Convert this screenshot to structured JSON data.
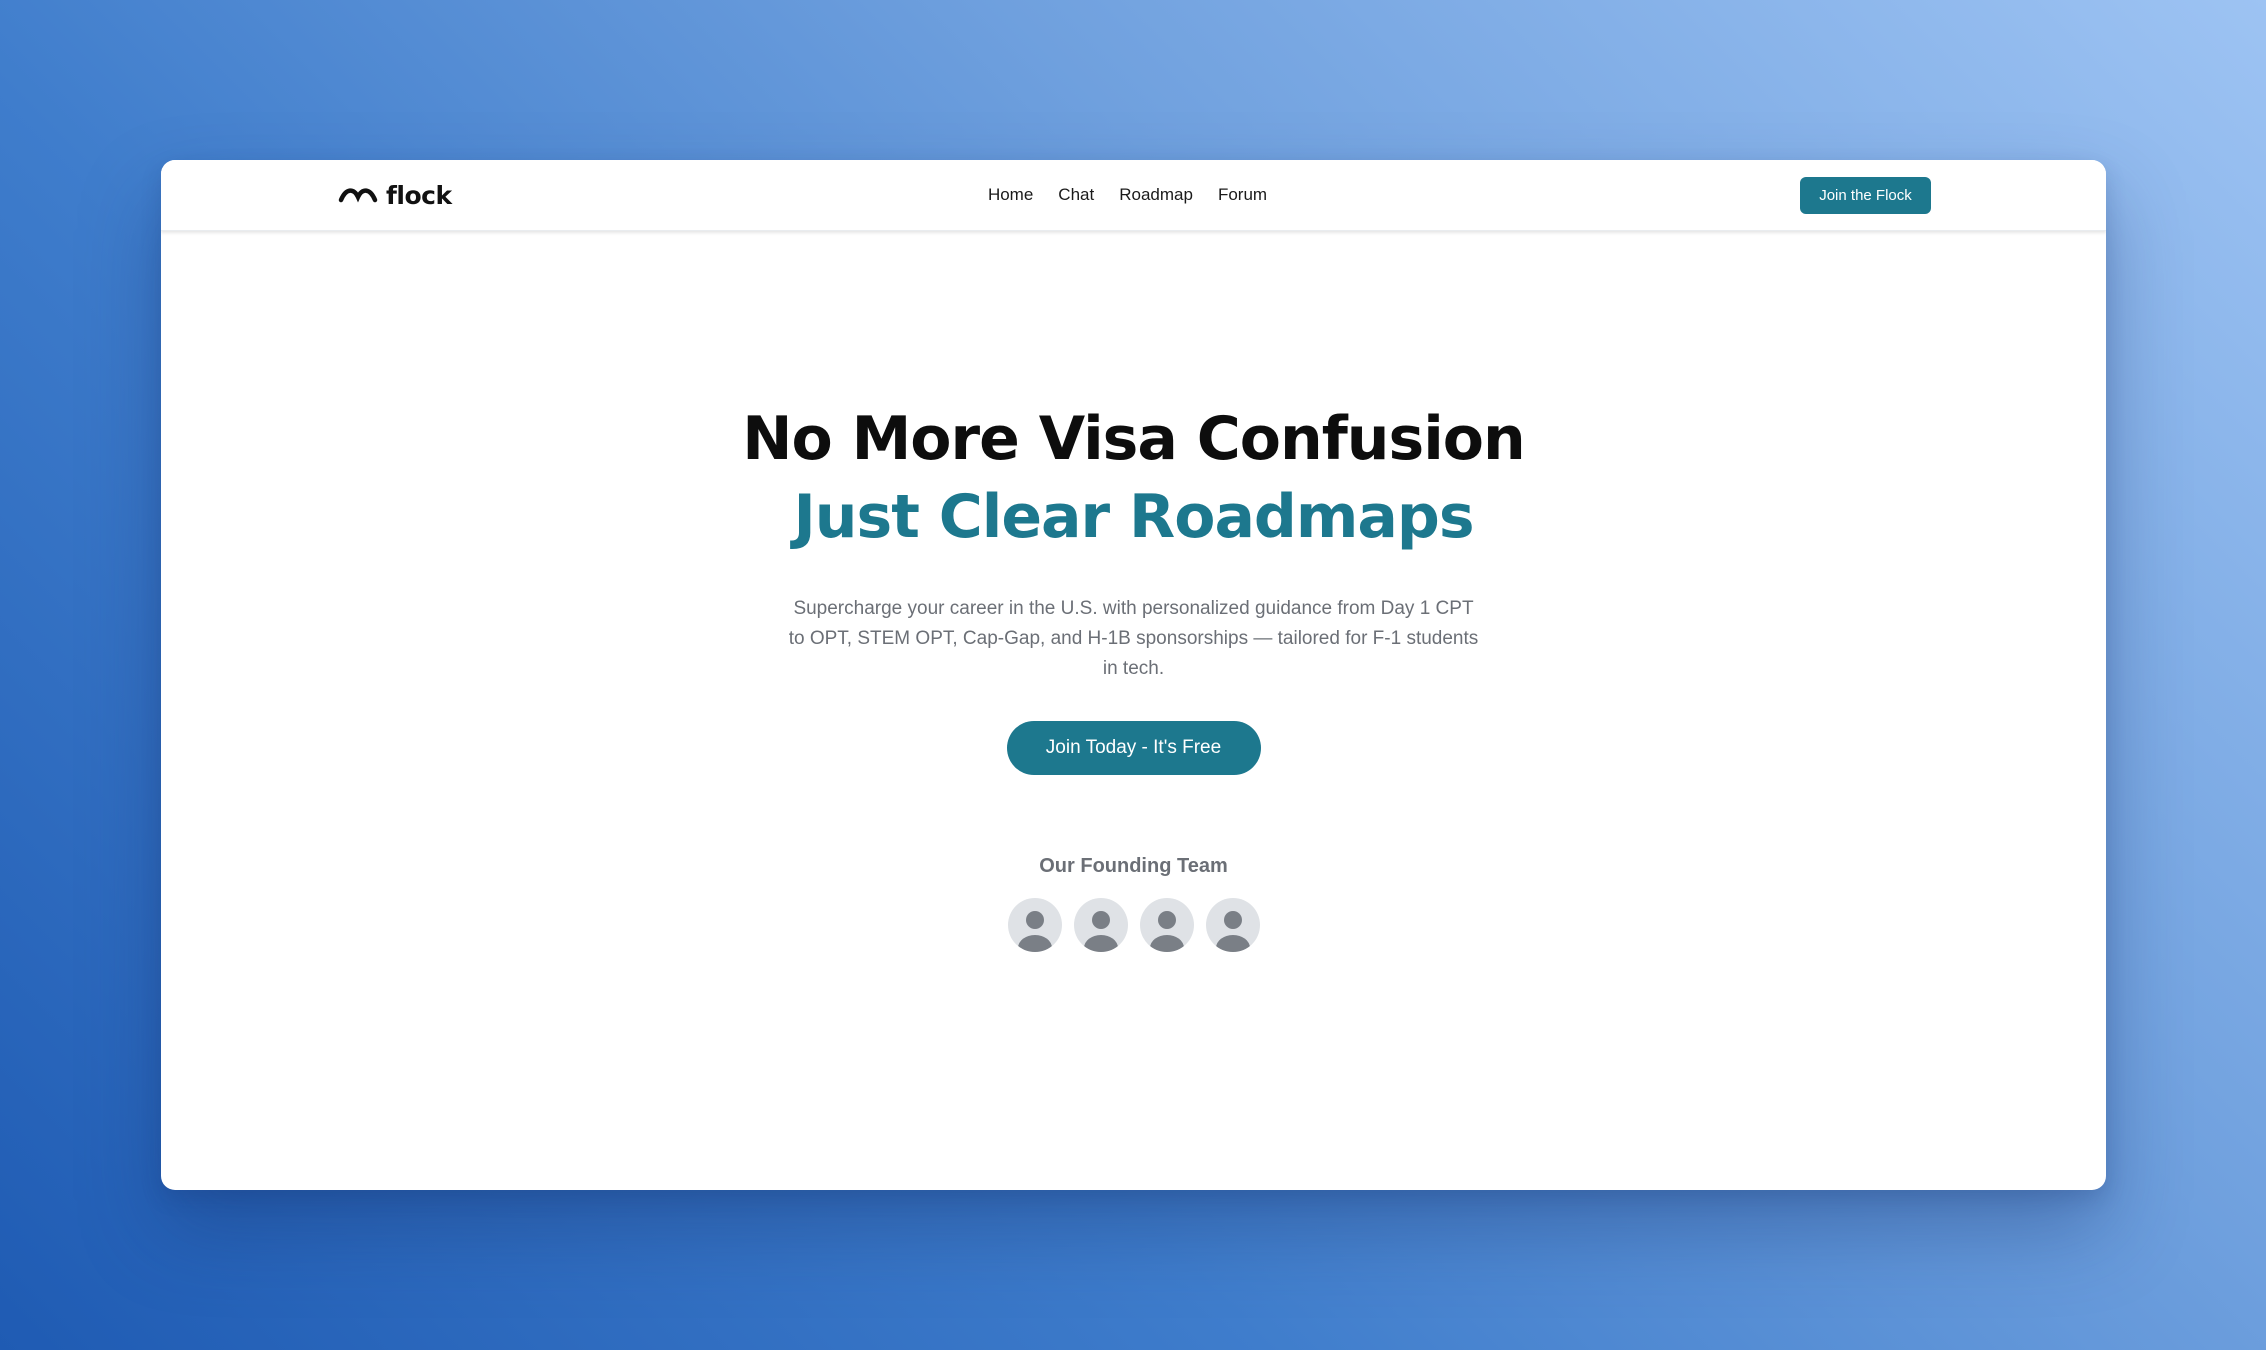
{
  "brand": {
    "name": "flock",
    "logo_icon": "wave-logo-icon"
  },
  "nav": {
    "links": [
      "Home",
      "Chat",
      "Roadmap",
      "Forum"
    ],
    "cta_label": "Join the Flock"
  },
  "hero": {
    "headline": "No More Visa Confusion",
    "headline_accent": "Just Clear Roadmaps",
    "subtext": "Supercharge your career in the U.S. with personalized guidance from Day 1 CPT to OPT, STEM OPT, Cap-Gap, and H-1B sponsorships — tailored for F-1 students in tech.",
    "cta_label": "Join Today - It's Free"
  },
  "team": {
    "title": "Our Founding Team",
    "avatar_icon": "user-placeholder-icon",
    "member_count": 4
  },
  "colors": {
    "accent": "#1d788e",
    "text_dark": "#0d0d0d",
    "text_muted": "#6b6f76",
    "avatar_bg": "#dfe2e6",
    "avatar_figure": "#7a7f86"
  }
}
